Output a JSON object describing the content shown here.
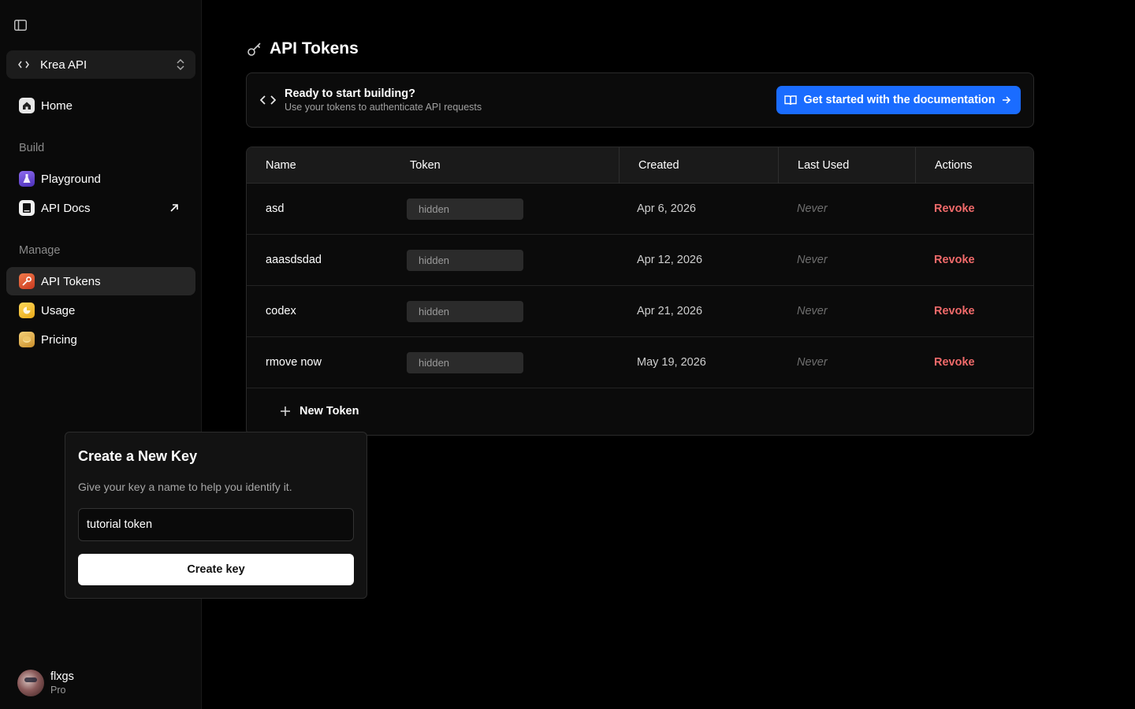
{
  "app": {
    "workspace_label": "Krea API"
  },
  "icons": {
    "sidebar_toggle": "sidebar-toggle-icon",
    "workspace": "code-icon",
    "chevron": "chevron-updown-icon",
    "home": "home-icon",
    "playground": "flask-icon",
    "api_docs": "docs-icon",
    "external": "arrow-up-right-icon",
    "api_tokens": "key-icon",
    "usage": "usage-icon",
    "pricing": "coin-icon",
    "page_title": "key-icon",
    "banner": "code-icon",
    "book": "book-icon",
    "arrow": "arrow-right-icon",
    "plus": "plus-icon"
  },
  "colors": {
    "accent": "#1a6cff",
    "revoke": "#f06a6a",
    "home_icon": "#e8e8e8",
    "playground_icon": "#6b4fd8",
    "docs_icon": "#f0f0f0",
    "tokens_icon": "#e0522e",
    "usage_icon": "#f2c230",
    "pricing_icon": "#e8b84a"
  },
  "sidebar": {
    "home": "Home",
    "build_label": "Build",
    "playground": "Playground",
    "api_docs": "API Docs",
    "manage_label": "Manage",
    "api_tokens": "API Tokens",
    "usage": "Usage",
    "pricing": "Pricing",
    "user": {
      "name": "flxgs",
      "plan": "Pro"
    }
  },
  "main": {
    "title": "API Tokens",
    "banner": {
      "title": "Ready to start building?",
      "subtitle": "Use your tokens to authenticate API requests",
      "button": "Get started with the documentation"
    },
    "table": {
      "headers": {
        "name": "Name",
        "token": "Token",
        "created": "Created",
        "last_used": "Last Used",
        "actions": "Actions"
      },
      "rows": [
        {
          "name": "asd",
          "token": "hidden",
          "created": "Apr 6, 2026",
          "last_used": "Never",
          "action": "Revoke"
        },
        {
          "name": "aaasdsdad",
          "token": "hidden",
          "created": "Apr 12, 2026",
          "last_used": "Never",
          "action": "Revoke"
        },
        {
          "name": "codex",
          "token": "hidden",
          "created": "Apr 21, 2026",
          "last_used": "Never",
          "action": "Revoke"
        },
        {
          "name": "rmove now",
          "token": "hidden",
          "created": "May 19, 2026",
          "last_used": "Never",
          "action": "Revoke"
        }
      ],
      "new_token": "New Token"
    }
  },
  "popover": {
    "title": "Create a New Key",
    "description": "Give your key a name to help you identify it.",
    "input_value": "tutorial token",
    "button": "Create key"
  }
}
